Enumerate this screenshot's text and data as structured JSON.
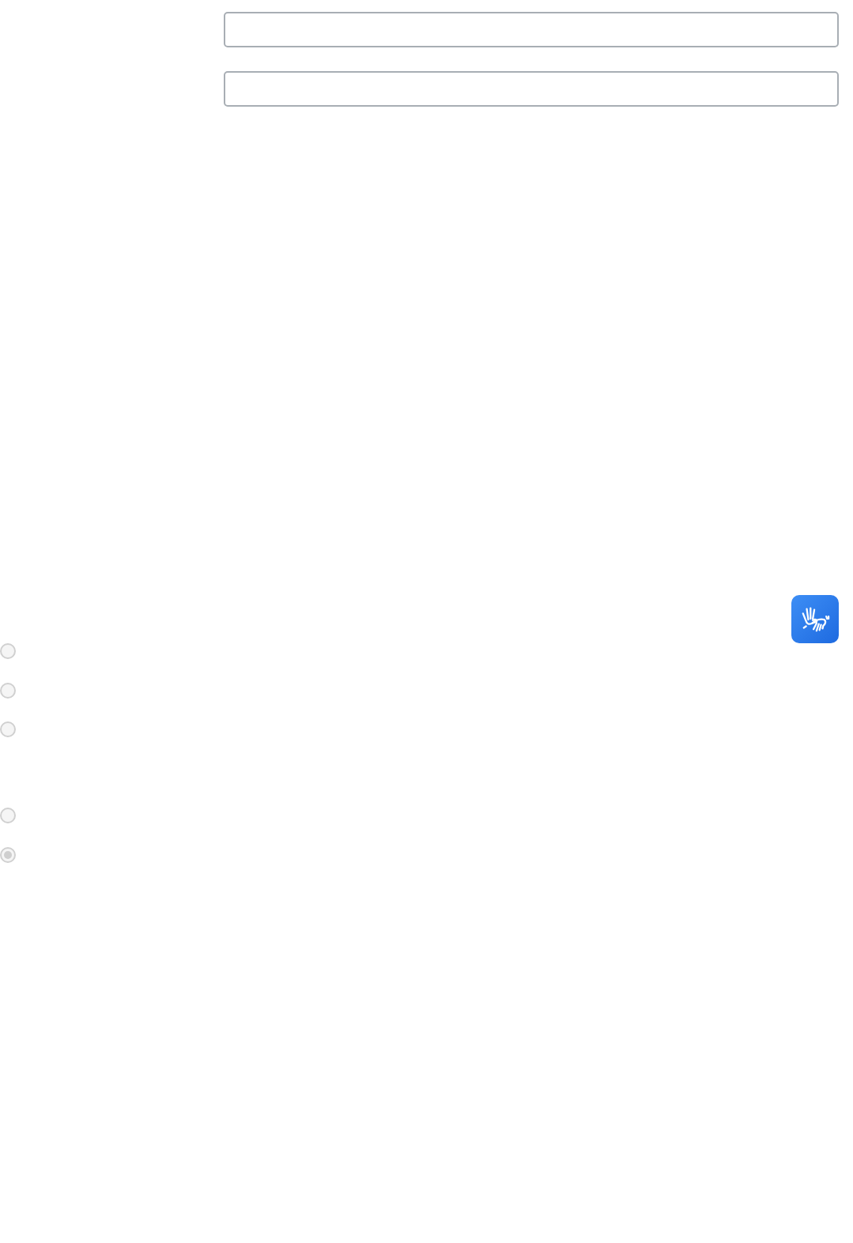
{
  "fields": [
    {
      "kind": "text"
    },
    {
      "kind": "text"
    }
  ],
  "radio_groups": [
    [
      {
        "selected": false,
        "disabled": true
      },
      {
        "selected": false,
        "disabled": true
      },
      {
        "selected": false,
        "disabled": true
      }
    ],
    [
      {
        "selected": false,
        "disabled": true
      },
      {
        "selected": true,
        "disabled": true
      }
    ]
  ],
  "accessibility_button": {
    "kind": "sign-language"
  }
}
